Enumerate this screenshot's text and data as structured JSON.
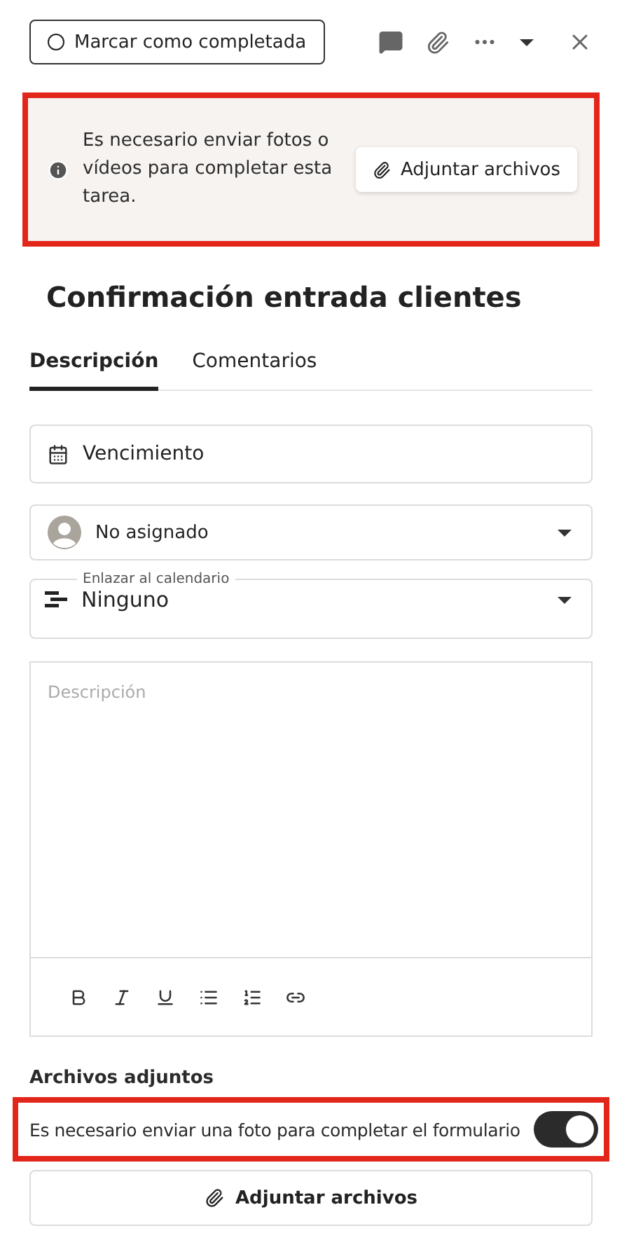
{
  "header": {
    "complete_button": "Marcar como completada"
  },
  "notice": {
    "text": "Es necesario enviar fotos o vídeos para completar esta tarea.",
    "button": "Adjuntar archivos"
  },
  "title": "Confirmación entrada clientes",
  "tabs": [
    {
      "label": "Descripción",
      "selected": true
    },
    {
      "label": "Comentarios",
      "selected": false
    }
  ],
  "due_field": {
    "placeholder": "Vencimiento"
  },
  "assignee_select": {
    "value": "No asignado"
  },
  "calendar_select": {
    "label": "Enlazar al calendario",
    "value": "Ninguno"
  },
  "description": {
    "placeholder": "Descripción"
  },
  "attachments": {
    "heading": "Archivos adjuntos",
    "required_label": "Es necesario enviar una foto para completar el formulario",
    "required_on": true,
    "button": "Adjuntar archivos"
  }
}
